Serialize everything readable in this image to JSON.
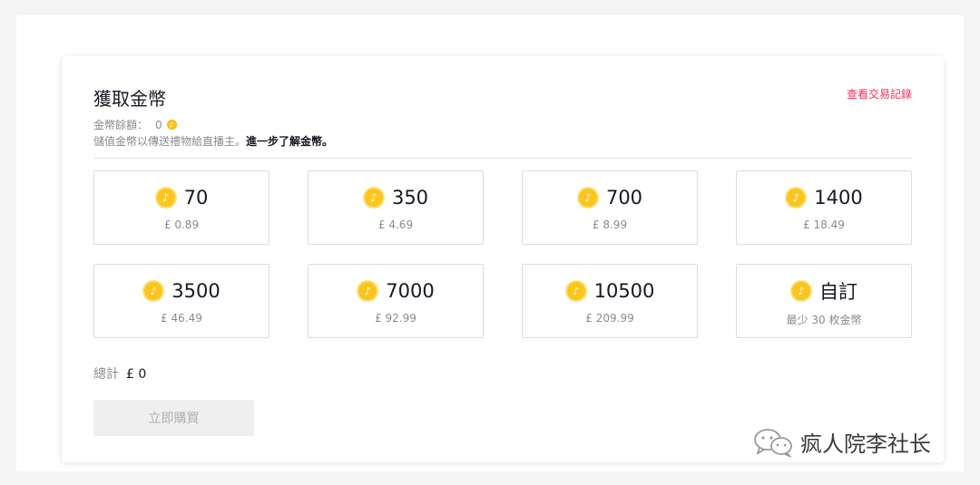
{
  "header": {
    "title": "獲取金幣",
    "history_link": "查看交易記錄"
  },
  "balance": {
    "label": "金幣餘額：",
    "value": "0"
  },
  "description": {
    "text": "儲值金幣以傳送禮物給直播主。",
    "learn_more": "進一步了解金幣。"
  },
  "packages": [
    {
      "amount": "70",
      "price": "£ 0.89"
    },
    {
      "amount": "350",
      "price": "£ 4.69"
    },
    {
      "amount": "700",
      "price": "£ 8.99"
    },
    {
      "amount": "1400",
      "price": "£ 18.49"
    },
    {
      "amount": "3500",
      "price": "£ 46.49"
    },
    {
      "amount": "7000",
      "price": "£ 92.99"
    },
    {
      "amount": "10500",
      "price": "£ 209.99"
    },
    {
      "amount": "自訂",
      "price": "最少 30 枚金幣"
    }
  ],
  "total": {
    "label": "總計",
    "value": "£ 0"
  },
  "buy_button": "立即購買",
  "watermark": "疯人院李社长",
  "colors": {
    "accent": "#fe2c55",
    "coin": "#fcc51e",
    "text": "#161823",
    "muted": "#8a8b91"
  },
  "icons": {
    "coin": "tiktok-coin-icon",
    "watermark": "wechat-icon"
  }
}
